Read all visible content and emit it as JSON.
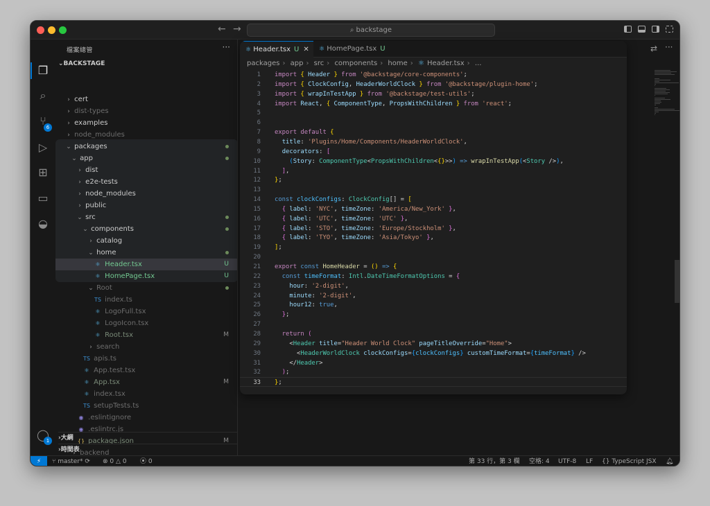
{
  "search": {
    "text": "backstage"
  },
  "sidebar": {
    "title": "檔案總管",
    "root": "BACKSTAGE",
    "items": [
      {
        "label": "cert",
        "depth": 0,
        "type": "folder",
        "open": false,
        "dim": false
      },
      {
        "label": "dist-types",
        "depth": 0,
        "type": "folder",
        "open": false,
        "dim": true
      },
      {
        "label": "examples",
        "depth": 0,
        "type": "folder",
        "open": false,
        "dim": false
      },
      {
        "label": "node_modules",
        "depth": 0,
        "type": "folder",
        "open": false,
        "dim": true
      },
      {
        "label": "packages",
        "depth": 0,
        "type": "folder",
        "open": true,
        "dot": true
      },
      {
        "label": "app",
        "depth": 1,
        "type": "folder",
        "open": true,
        "dot": true
      },
      {
        "label": "dist",
        "depth": 2,
        "type": "folder",
        "open": false
      },
      {
        "label": "e2e-tests",
        "depth": 2,
        "type": "folder",
        "open": false
      },
      {
        "label": "node_modules",
        "depth": 2,
        "type": "folder",
        "open": false
      },
      {
        "label": "public",
        "depth": 2,
        "type": "folder",
        "open": false
      },
      {
        "label": "src",
        "depth": 2,
        "type": "folder",
        "open": true,
        "dot": true
      },
      {
        "label": "components",
        "depth": 3,
        "type": "folder",
        "open": true,
        "dot": true
      },
      {
        "label": "catalog",
        "depth": 4,
        "type": "folder",
        "open": false
      },
      {
        "label": "home",
        "depth": 4,
        "type": "folder",
        "open": true,
        "dot": true
      },
      {
        "label": "Header.tsx",
        "depth": 5,
        "type": "react",
        "status": "U",
        "selected": true
      },
      {
        "label": "HomePage.tsx",
        "depth": 5,
        "type": "react",
        "status": "U"
      },
      {
        "label": "Root",
        "depth": 4,
        "type": "folder",
        "open": true,
        "dim": true,
        "dot": true
      },
      {
        "label": "index.ts",
        "depth": 5,
        "type": "ts",
        "dim": true
      },
      {
        "label": "LogoFull.tsx",
        "depth": 5,
        "type": "react",
        "dim": true
      },
      {
        "label": "LogoIcon.tsx",
        "depth": 5,
        "type": "react",
        "dim": true
      },
      {
        "label": "Root.tsx",
        "depth": 5,
        "type": "react",
        "dim": true,
        "status": "M"
      },
      {
        "label": "search",
        "depth": 4,
        "type": "folder",
        "open": false,
        "dim": true
      },
      {
        "label": "apis.ts",
        "depth": 3,
        "type": "ts",
        "dim": true
      },
      {
        "label": "App.test.tsx",
        "depth": 3,
        "type": "react",
        "dim": true
      },
      {
        "label": "App.tsx",
        "depth": 3,
        "type": "react",
        "dim": true,
        "status": "M"
      },
      {
        "label": "index.tsx",
        "depth": 3,
        "type": "react",
        "dim": true
      },
      {
        "label": "setupTests.ts",
        "depth": 3,
        "type": "ts",
        "dim": true
      },
      {
        "label": ".eslintignore",
        "depth": 2,
        "type": "eslint",
        "dim": true
      },
      {
        "label": ".eslintrc.js",
        "depth": 2,
        "type": "eslint",
        "dim": true
      },
      {
        "label": "package.json",
        "depth": 2,
        "type": "json",
        "dim": true,
        "status": "M"
      },
      {
        "label": "backend",
        "depth": 1,
        "type": "folder",
        "open": false,
        "dim": true
      }
    ],
    "outline": "大綱",
    "timeline": "時間表"
  },
  "tabs": [
    {
      "label": "Header.tsx",
      "status": "U"
    },
    {
      "label": "HomePage.tsx",
      "status": "U"
    }
  ],
  "breadcrumb": [
    "packages",
    "app",
    "src",
    "components",
    "home",
    "Header.tsx",
    "..."
  ],
  "activity": {
    "scm_badge": "6",
    "account_badge": "1"
  },
  "code": [
    [
      [
        "kw",
        "import"
      ],
      [
        "pl",
        " "
      ],
      [
        "br1",
        "{"
      ],
      [
        "pl",
        " "
      ],
      [
        "vr",
        "Header"
      ],
      [
        "pl",
        " "
      ],
      [
        "br1",
        "}"
      ],
      [
        "kw",
        " from "
      ],
      [
        "str",
        "'@backstage/core-components'"
      ],
      [
        "pl",
        ";"
      ]
    ],
    [
      [
        "kw",
        "import"
      ],
      [
        "pl",
        " "
      ],
      [
        "br1",
        "{"
      ],
      [
        "pl",
        " "
      ],
      [
        "vr",
        "ClockConfig"
      ],
      [
        "pl",
        ", "
      ],
      [
        "vr",
        "HeaderWorldClock"
      ],
      [
        "pl",
        " "
      ],
      [
        "br1",
        "}"
      ],
      [
        "kw",
        " from "
      ],
      [
        "str",
        "'@backstage/plugin-home'"
      ],
      [
        "pl",
        ";"
      ]
    ],
    [
      [
        "kw",
        "import"
      ],
      [
        "pl",
        " "
      ],
      [
        "br1",
        "{"
      ],
      [
        "pl",
        " "
      ],
      [
        "vr",
        "wrapInTestApp"
      ],
      [
        "pl",
        " "
      ],
      [
        "br1",
        "}"
      ],
      [
        "kw",
        " from "
      ],
      [
        "str",
        "'@backstage/test-utils'"
      ],
      [
        "pl",
        ";"
      ]
    ],
    [
      [
        "kw",
        "import"
      ],
      [
        "pl",
        " "
      ],
      [
        "vr",
        "React"
      ],
      [
        "pl",
        ", "
      ],
      [
        "br1",
        "{"
      ],
      [
        "pl",
        " "
      ],
      [
        "vr",
        "ComponentType"
      ],
      [
        "pl",
        ", "
      ],
      [
        "vr",
        "PropsWithChildren"
      ],
      [
        "pl",
        " "
      ],
      [
        "br1",
        "}"
      ],
      [
        "kw",
        " from "
      ],
      [
        "str",
        "'react'"
      ],
      [
        "pl",
        ";"
      ]
    ],
    [],
    [],
    [
      [
        "kw",
        "export default"
      ],
      [
        "pl",
        " "
      ],
      [
        "br1",
        "{"
      ]
    ],
    [
      [
        "pl",
        "  "
      ],
      [
        "vr",
        "title"
      ],
      [
        "pl",
        ": "
      ],
      [
        "str",
        "'Plugins/Home/Components/HeaderWorldClock'"
      ],
      [
        "pl",
        ","
      ]
    ],
    [
      [
        "pl",
        "  "
      ],
      [
        "vr",
        "decorators"
      ],
      [
        "pl",
        ": "
      ],
      [
        "br2",
        "["
      ]
    ],
    [
      [
        "pl",
        "    "
      ],
      [
        "br3",
        "("
      ],
      [
        "vr",
        "Story"
      ],
      [
        "pl",
        ": "
      ],
      [
        "ty",
        "ComponentType"
      ],
      [
        "pl",
        "<"
      ],
      [
        "ty",
        "PropsWithChildren"
      ],
      [
        "pl",
        "<"
      ],
      [
        "br1",
        "{}"
      ],
      [
        "pl",
        ">>"
      ],
      [
        "br3",
        ")"
      ],
      [
        "kw2",
        " => "
      ],
      [
        "fn",
        "wrapInTestApp"
      ],
      [
        "br3",
        "("
      ],
      [
        "pl",
        "<"
      ],
      [
        "ty",
        "Story"
      ],
      [
        "pl",
        " />"
      ],
      [
        "br3",
        ")"
      ],
      [
        "pl",
        ","
      ]
    ],
    [
      [
        "pl",
        "  "
      ],
      [
        "br2",
        "]"
      ],
      [
        "pl",
        ","
      ]
    ],
    [
      [
        "br1",
        "}"
      ],
      [
        "pl",
        ";"
      ]
    ],
    [],
    [
      [
        "kw2",
        "const"
      ],
      [
        "pl",
        " "
      ],
      [
        "cn",
        "clockConfigs"
      ],
      [
        "pl",
        ": "
      ],
      [
        "ty",
        "ClockConfig"
      ],
      [
        "pl",
        "[] = "
      ],
      [
        "br1",
        "["
      ]
    ],
    [
      [
        "pl",
        "  "
      ],
      [
        "br2",
        "{"
      ],
      [
        "pl",
        " "
      ],
      [
        "vr",
        "label"
      ],
      [
        "pl",
        ": "
      ],
      [
        "str",
        "'NYC'"
      ],
      [
        "pl",
        ", "
      ],
      [
        "vr",
        "timeZone"
      ],
      [
        "pl",
        ": "
      ],
      [
        "str",
        "'America/New_York'"
      ],
      [
        "pl",
        " "
      ],
      [
        "br2",
        "}"
      ],
      [
        "pl",
        ","
      ]
    ],
    [
      [
        "pl",
        "  "
      ],
      [
        "br2",
        "{"
      ],
      [
        "pl",
        " "
      ],
      [
        "vr",
        "label"
      ],
      [
        "pl",
        ": "
      ],
      [
        "str",
        "'UTC'"
      ],
      [
        "pl",
        ", "
      ],
      [
        "vr",
        "timeZone"
      ],
      [
        "pl",
        ": "
      ],
      [
        "str",
        "'UTC'"
      ],
      [
        "pl",
        " "
      ],
      [
        "br2",
        "}"
      ],
      [
        "pl",
        ","
      ]
    ],
    [
      [
        "pl",
        "  "
      ],
      [
        "br2",
        "{"
      ],
      [
        "pl",
        " "
      ],
      [
        "vr",
        "label"
      ],
      [
        "pl",
        ": "
      ],
      [
        "str",
        "'STO'"
      ],
      [
        "pl",
        ", "
      ],
      [
        "vr",
        "timeZone"
      ],
      [
        "pl",
        ": "
      ],
      [
        "str",
        "'Europe/Stockholm'"
      ],
      [
        "pl",
        " "
      ],
      [
        "br2",
        "}"
      ],
      [
        "pl",
        ","
      ]
    ],
    [
      [
        "pl",
        "  "
      ],
      [
        "br2",
        "{"
      ],
      [
        "pl",
        " "
      ],
      [
        "vr",
        "label"
      ],
      [
        "pl",
        ": "
      ],
      [
        "str",
        "'TYO'"
      ],
      [
        "pl",
        ", "
      ],
      [
        "vr",
        "timeZone"
      ],
      [
        "pl",
        ": "
      ],
      [
        "str",
        "'Asia/Tokyo'"
      ],
      [
        "pl",
        " "
      ],
      [
        "br2",
        "}"
      ],
      [
        "pl",
        ","
      ]
    ],
    [
      [
        "br1",
        "]"
      ],
      [
        "pl",
        ";"
      ]
    ],
    [],
    [
      [
        "kw",
        "export"
      ],
      [
        "kw2",
        " const "
      ],
      [
        "fn",
        "HomeHeader"
      ],
      [
        "pl",
        " = "
      ],
      [
        "br1",
        "()"
      ],
      [
        "kw2",
        " => "
      ],
      [
        "br1",
        "{"
      ]
    ],
    [
      [
        "pl",
        "  "
      ],
      [
        "kw2",
        "const"
      ],
      [
        "pl",
        " "
      ],
      [
        "cn",
        "timeFormat"
      ],
      [
        "pl",
        ": "
      ],
      [
        "ty",
        "Intl"
      ],
      [
        "pl",
        "."
      ],
      [
        "ty",
        "DateTimeFormatOptions"
      ],
      [
        "pl",
        " = "
      ],
      [
        "br2",
        "{"
      ]
    ],
    [
      [
        "pl",
        "    "
      ],
      [
        "vr",
        "hour"
      ],
      [
        "pl",
        ": "
      ],
      [
        "str",
        "'2-digit'"
      ],
      [
        "pl",
        ","
      ]
    ],
    [
      [
        "pl",
        "    "
      ],
      [
        "vr",
        "minute"
      ],
      [
        "pl",
        ": "
      ],
      [
        "str",
        "'2-digit'"
      ],
      [
        "pl",
        ","
      ]
    ],
    [
      [
        "pl",
        "    "
      ],
      [
        "vr",
        "hour12"
      ],
      [
        "pl",
        ": "
      ],
      [
        "kw2",
        "true"
      ],
      [
        "pl",
        ","
      ]
    ],
    [
      [
        "pl",
        "  "
      ],
      [
        "br2",
        "}"
      ],
      [
        "pl",
        ";"
      ]
    ],
    [],
    [
      [
        "pl",
        "  "
      ],
      [
        "kw",
        "return"
      ],
      [
        "pl",
        " "
      ],
      [
        "br2",
        "("
      ]
    ],
    [
      [
        "pl",
        "    <"
      ],
      [
        "ty",
        "Header"
      ],
      [
        "pl",
        " "
      ],
      [
        "at",
        "title"
      ],
      [
        "pl",
        "="
      ],
      [
        "str",
        "\"Header World Clock\""
      ],
      [
        "pl",
        " "
      ],
      [
        "at",
        "pageTitleOverride"
      ],
      [
        "pl",
        "="
      ],
      [
        "str",
        "\"Home\""
      ],
      [
        "pl",
        ">"
      ]
    ],
    [
      [
        "pl",
        "      <"
      ],
      [
        "ty",
        "HeaderWorldClock"
      ],
      [
        "pl",
        " "
      ],
      [
        "at",
        "clockConfigs"
      ],
      [
        "pl",
        "="
      ],
      [
        "br3",
        "{"
      ],
      [
        "cn",
        "clockConfigs"
      ],
      [
        "br3",
        "}"
      ],
      [
        "pl",
        " "
      ],
      [
        "at",
        "customTimeFormat"
      ],
      [
        "pl",
        "="
      ],
      [
        "br3",
        "{"
      ],
      [
        "cn",
        "timeFormat"
      ],
      [
        "br3",
        "}"
      ],
      [
        "pl",
        " />"
      ]
    ],
    [
      [
        "pl",
        "    </"
      ],
      [
        "ty",
        "Header"
      ],
      [
        "pl",
        ">"
      ]
    ],
    [
      [
        "pl",
        "  "
      ],
      [
        "br2",
        ")"
      ],
      [
        "pl",
        ";"
      ]
    ],
    [
      [
        "br1",
        "}"
      ],
      [
        "pl",
        ";"
      ]
    ]
  ],
  "status": {
    "branch": "master*",
    "errors": "0",
    "warnings": "0",
    "ports": "0",
    "position": "第 33 行，第 3 欄",
    "spaces": "空格: 4",
    "encoding": "UTF-8",
    "eol": "LF",
    "language": "TypeScript JSX"
  }
}
